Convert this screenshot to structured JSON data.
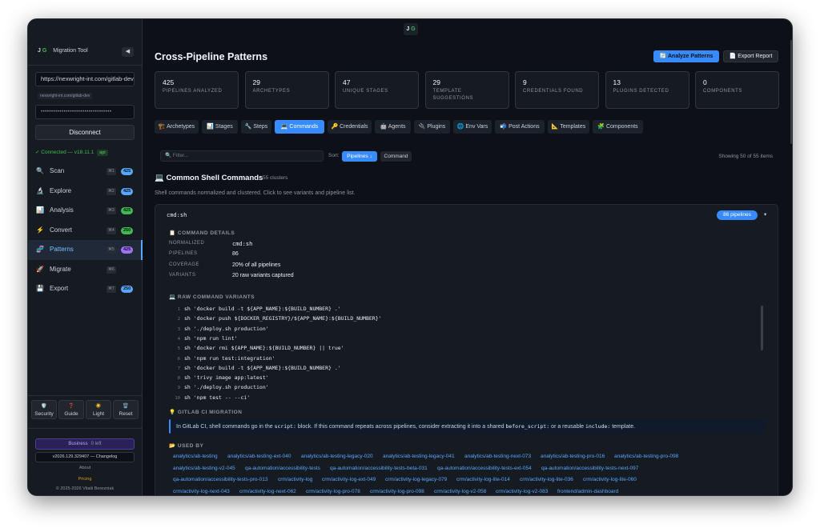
{
  "titlebar": {
    "logo_j": "J",
    "logo_g": "G"
  },
  "sidebar": {
    "brand_j": "J",
    "brand_g": "G",
    "brand_name": "Migration Tool",
    "collapse_icon": "◀",
    "url_value": "https://nexwright-int.com/gitlab-dev",
    "url_hint": "nexwright-int.com/gitlab-dev",
    "password_mask": "••••••••••••••••••••••••••••••••••",
    "disconnect_label": "Disconnect",
    "connection_status": "✓ Connected — v18.11.1",
    "connection_tag": "api",
    "nav": [
      {
        "icon": "🔍",
        "label": "Scan",
        "key": "⌘1",
        "badge": "425",
        "badge_color": "#58a6ff"
      },
      {
        "icon": "🔬",
        "label": "Explore",
        "key": "⌘2",
        "badge": "425",
        "badge_color": "#58a6ff"
      },
      {
        "icon": "📊",
        "label": "Analysis",
        "key": "⌘3",
        "badge": "425",
        "badge_color": "#3fb950"
      },
      {
        "icon": "⚡",
        "label": "Convert",
        "key": "⌘4",
        "badge": "250",
        "badge_color": "#3fb950"
      },
      {
        "icon": "🧬",
        "label": "Patterns",
        "key": "⌘5",
        "badge": "425",
        "badge_color": "#a371f7"
      },
      {
        "icon": "🚀",
        "label": "Migrate",
        "key": "⌘6",
        "badge": "",
        "badge_color": ""
      },
      {
        "icon": "💾",
        "label": "Export",
        "key": "⌘7",
        "badge": "250",
        "badge_color": "#58a6ff"
      }
    ],
    "tools": [
      {
        "icon": "🛡️",
        "label": "Security"
      },
      {
        "icon": "❓",
        "label": "Guide"
      },
      {
        "icon": "☀️",
        "label": "Light"
      },
      {
        "icon": "🗑️",
        "label": "Reset"
      }
    ],
    "plan_name": "Business",
    "plan_left": "0 left",
    "version": "v2026.129.329407 — Changelog",
    "about": "About",
    "pricing": "Pricing",
    "copyright": "© 2025-2026 Vitalii Berezniak"
  },
  "header": {
    "title": "Cross-Pipeline Patterns",
    "analyze_label": "🔄 Analyze Patterns",
    "export_label": "📄 Export Report"
  },
  "stats": [
    {
      "value": "425",
      "label": "PIPELINES ANALYZED"
    },
    {
      "value": "29",
      "label": "ARCHETYPES"
    },
    {
      "value": "47",
      "label": "UNIQUE STAGES"
    },
    {
      "value": "29",
      "label": "TEMPLATE SUGGESTIONS"
    },
    {
      "value": "9",
      "label": "CREDENTIALS FOUND"
    },
    {
      "value": "13",
      "label": "PLUGINS DETECTED"
    },
    {
      "value": "0",
      "label": "COMPONENTS"
    }
  ],
  "tabs": [
    {
      "label": "🏗️ Archetypes"
    },
    {
      "label": "📊 Stages"
    },
    {
      "label": "🔧 Steps"
    },
    {
      "label": "💻 Commands"
    },
    {
      "label": "🔑 Credentials"
    },
    {
      "label": "🤖 Agents"
    },
    {
      "label": "🔌 Plugins"
    },
    {
      "label": "🌐 Env Vars"
    },
    {
      "label": "📬 Post Actions"
    },
    {
      "label": "📐 Templates"
    },
    {
      "label": "🧩 Components"
    }
  ],
  "filter": {
    "placeholder": "🔍 Filter..."
  },
  "sort": {
    "label": "Sort:",
    "option_active": "Pipelines ↓",
    "option_other": "Command"
  },
  "showing": "Showing 50 of 55 items",
  "section": {
    "title": "💻 Common Shell Commands",
    "clusters": "55 clusters",
    "description": "Shell commands normalized and clustered. Click to see variants and pipeline list."
  },
  "command": {
    "name": "cmd:sh",
    "pipelines_pill": "86 pipelines",
    "caret": "▾",
    "details_heading": "📋 COMMAND DETAILS",
    "details": [
      {
        "key": "NORMALIZED",
        "value": "cmd:sh",
        "mono": true
      },
      {
        "key": "PIPELINES",
        "value": "86",
        "mono": false
      },
      {
        "key": "COVERAGE",
        "value": "20% of all pipelines",
        "mono": false
      },
      {
        "key": "VARIANTS",
        "value": "20 raw variants captured",
        "mono": false
      }
    ],
    "variants_heading": "💻 RAW COMMAND VARIANTS",
    "variants": [
      {
        "n": "1",
        "text": "sh 'docker build -t ${APP_NAME}:${BUILD_NUMBER} .'"
      },
      {
        "n": "2",
        "text": "sh 'docker push ${DOCKER_REGISTRY}/${APP_NAME}:${BUILD_NUMBER}'"
      },
      {
        "n": "3",
        "text": "sh './deploy.sh production'"
      },
      {
        "n": "4",
        "text": "sh 'npm run lint'"
      },
      {
        "n": "5",
        "text": "sh 'docker rmi ${APP_NAME}:${BUILD_NUMBER} || true'"
      },
      {
        "n": "6",
        "text": "sh 'npm run test:integration'"
      },
      {
        "n": "7",
        "text": "sh 'docker build -t ${APP_NAME}:${BUILD_NUMBER} .'"
      },
      {
        "n": "8",
        "text": "sh 'trivy image app:latest'"
      },
      {
        "n": "9",
        "text": "sh './deploy.sh production'"
      },
      {
        "n": "10",
        "text": "sh 'npm test -- --ci'"
      }
    ],
    "migration_heading": "💡 GITLAB CI MIGRATION",
    "migration_parts": [
      "In GitLab CI, shell commands go in the ",
      "script:",
      " block. If this command repeats across pipelines, consider extracting it into a shared ",
      "before_script:",
      " or a reusable ",
      "include:",
      " template."
    ],
    "used_heading": "📂 USED BY",
    "used_by": [
      "analytics/ab-testing",
      "analytics/ab-testing-ext-040",
      "analytics/ab-testing-legacy-020",
      "analytics/ab-testing-legacy-041",
      "analytics/ab-testing-next-073",
      "analytics/ab-testing-pro-016",
      "analytics/ab-testing-pro-098",
      "analytics/ab-testing-v2-045",
      "qa-automation/accessibility-tests",
      "qa-automation/accessibility-tests-beta-031",
      "qa-automation/accessibility-tests-ext-054",
      "qa-automation/accessibility-tests-next-097",
      "qa-automation/accessibility-tests-pro-013",
      "crm/activity-log",
      "crm/activity-log-ext-049",
      "crm/activity-log-legacy-079",
      "crm/activity-log-lite-014",
      "crm/activity-log-lite-036",
      "crm/activity-log-lite-060",
      "crm/activity-log-next-043",
      "crm/activity-log-next-062",
      "crm/activity-log-pro-078",
      "crm/activity-log-pro-098",
      "crm/activity-log-v2-058",
      "crm/activity-log-v2-083",
      "frontend/admin-dashboard"
    ]
  }
}
